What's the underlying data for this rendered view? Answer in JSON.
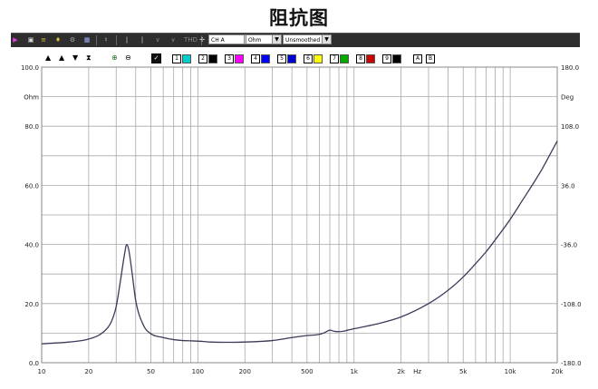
{
  "page_title": "阻抗图",
  "toolbar": {
    "buttons": [
      "",
      "",
      "",
      "",
      "",
      "",
      "",
      "",
      "THD"
    ],
    "channel": "CH A",
    "unit": "Ohm",
    "smoothing": "Unsmoothed",
    "icons": [
      "marker-icon",
      "save-icon",
      "equalizer-icon",
      "probe-icon",
      "gear-icon",
      "image-icon",
      "mic-icon",
      "cursor-icon"
    ]
  },
  "trace_buttons": [
    "1",
    "2",
    "3",
    "4",
    "5",
    "6",
    "7",
    "8",
    "9"
  ],
  "trace_colors": [
    "#000000",
    "#00cccc",
    "#000000",
    "#ff00ff",
    "#0000ff",
    "#0000cc",
    "#ffff00",
    "#00aa00",
    "#cc0000",
    "#000000"
  ],
  "ab_buttons": [
    "A",
    "B"
  ],
  "left_axis": {
    "top_label": "100.0",
    "unit": "Ohm",
    "ticks": [
      "100.0",
      "80.0",
      "60.0",
      "40.0",
      "20.0",
      "0.0"
    ]
  },
  "right_axis": {
    "top_label": "180.0",
    "unit": "Deg",
    "ticks": [
      "180.0",
      "108.0",
      "36.0",
      "-36.0",
      "-108.0",
      "-180.0"
    ]
  },
  "x_axis": {
    "ticks": [
      "10",
      "20",
      "50",
      "100",
      "200",
      "500",
      "1k",
      "2k",
      "5k",
      "10k",
      "20k"
    ],
    "unit": "Hz"
  },
  "chart_data": {
    "type": "line",
    "title": "阻抗图",
    "xlabel": "Hz",
    "ylabel": "Ohm",
    "x_scale": "log",
    "xlim": [
      10,
      20000
    ],
    "ylim": [
      0,
      100
    ],
    "y2lim": [
      -180,
      180
    ],
    "grid": true,
    "series": [
      {
        "color": "#3a3a5a",
        "x": [
          10,
          15,
          20,
          25,
          28,
          30,
          32,
          34,
          35,
          36,
          38,
          40,
          45,
          50,
          60,
          70,
          80,
          90,
          100,
          120,
          150,
          200,
          300,
          400,
          500,
          600,
          650,
          700,
          750,
          800,
          1000,
          1500,
          2000,
          3000,
          4000,
          5000,
          6000,
          7000,
          8000,
          10000,
          12000,
          14000,
          16000,
          18000,
          20000
        ],
        "y": [
          6.4,
          7.0,
          8.0,
          10.5,
          14.0,
          19.0,
          28.0,
          37.0,
          40.0,
          38.5,
          30.0,
          21.0,
          12.5,
          9.8,
          8.5,
          7.8,
          7.5,
          7.4,
          7.3,
          7.0,
          6.9,
          7.0,
          7.5,
          8.5,
          9.2,
          9.6,
          10.2,
          11.0,
          10.6,
          10.5,
          11.5,
          13.5,
          15.5,
          20.0,
          24.5,
          29.0,
          33.5,
          37.5,
          41.5,
          48.5,
          55.0,
          60.5,
          65.5,
          70.5,
          75.0
        ]
      }
    ]
  }
}
